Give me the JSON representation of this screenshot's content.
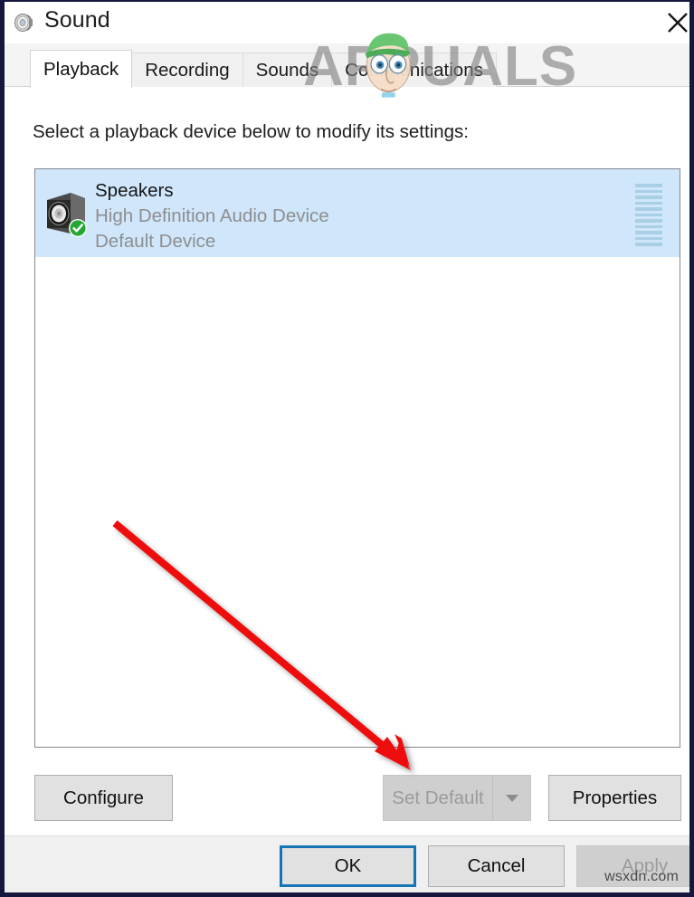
{
  "window": {
    "title": "Sound",
    "title_icon": "speaker-icon",
    "close_label": "×"
  },
  "tabs": [
    {
      "label": "Playback",
      "active": true
    },
    {
      "label": "Recording",
      "active": false
    },
    {
      "label": "Sounds",
      "active": false
    },
    {
      "label": "Communications",
      "active": false
    }
  ],
  "main": {
    "instruction": "Select a playback device below to modify its settings:"
  },
  "devices": [
    {
      "name": "Speakers",
      "driver": "High Definition Audio Device",
      "status": "Default Device",
      "icon": "speaker-device-icon",
      "badge": "green-check-icon",
      "selected": true,
      "meter_segments": 11
    }
  ],
  "actions": {
    "configure": "Configure",
    "set_default": "Set Default",
    "set_default_dropdown_icon": "chevron-down-icon",
    "set_default_disabled": true,
    "properties": "Properties"
  },
  "footer": {
    "ok": "OK",
    "cancel": "Cancel",
    "apply": "Apply",
    "apply_disabled": true,
    "ok_focused": true
  },
  "watermarks": {
    "brand": "APPUALS",
    "site": "wsxdn.com"
  },
  "annotation": {
    "type": "red-arrow",
    "points_to": "Set Default",
    "color": "#ee1111"
  },
  "colors": {
    "window_border": "#15173d",
    "selection": "#cfe6fb",
    "focus_ring": "#1574b3",
    "disabled_text": "#9b9b9b",
    "secondary_text": "#8e8e8e",
    "arrow": "#ee1111"
  }
}
